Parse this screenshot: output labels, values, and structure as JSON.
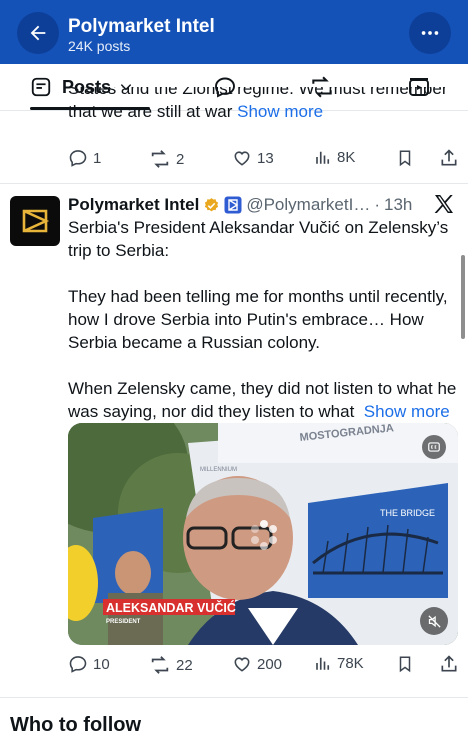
{
  "header": {
    "title": "Polymarket Intel",
    "subtitle": "24K posts",
    "bg_color": "#1452b8"
  },
  "tabs": {
    "posts_label": "Posts",
    "icons": [
      "reply-icon",
      "repost-icon",
      "video-icon"
    ]
  },
  "prev_tweet": {
    "cut_line": "States and the Zionist regime. We must remember",
    "last_line": "that we are still at war",
    "show_more": "Show more",
    "replies": "1",
    "reposts": "2",
    "likes": "13",
    "views": "8K"
  },
  "tweet": {
    "name": "Polymarket Intel",
    "handle": "@PolymarketI…",
    "separator": "·",
    "time": "13h",
    "paragraphs": [
      "Serbia's President Aleksandar Vučić on Zelensky’s trip to Serbia:",
      "They had been telling me for months until recently, how I drove Serbia into Putin's embrace… How Serbia became a Russian colony.",
      "When Zelensky came, they did not listen to what he was saying, nor did they listen to what"
    ],
    "show_more": "Show more",
    "media": {
      "banner_text": "MOSTOGRADNJA",
      "bridge_label": "THE BRIDGE",
      "brand_text": "MILLENNIUM",
      "lower_third_name": "ALEKSANDAR VUČIĆ",
      "lower_third_role": "PRESIDENT"
    },
    "replies": "10",
    "reposts": "22",
    "likes": "200",
    "views": "78K"
  },
  "section_header": "Who to follow"
}
